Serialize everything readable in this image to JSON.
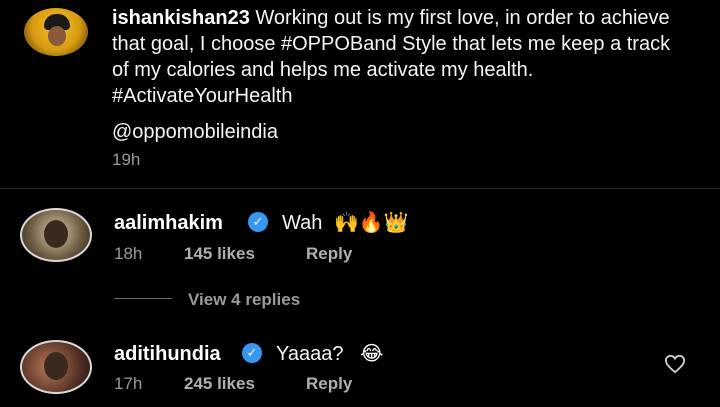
{
  "post": {
    "username": "ishankishan23",
    "caption": "Working out is my first love, in order to achieve that goal, I choose #OPPOBand Style that lets me keep a track of my calories and helps me activate my health. #ActivateYourHealth",
    "mention": "@oppomobileindia",
    "time": "19h"
  },
  "comments": [
    {
      "username": "aalimhakim",
      "verified": true,
      "text": "Wah",
      "emojis": "🙌🔥👑",
      "time": "18h",
      "likes": "145 likes",
      "reply": "Reply"
    },
    {
      "username": "aditihundia",
      "verified": true,
      "text": "Yaaaa?",
      "emojis": "😂",
      "time": "17h",
      "likes": "245 likes",
      "reply": "Reply"
    }
  ],
  "view_replies": "View 4 replies",
  "colors": {
    "background": "#000000",
    "verified": "#3897f0",
    "muted_text": "#9a9a9a"
  },
  "icons": {
    "verified": "verified-badge-icon",
    "like": "heart-outline-icon"
  }
}
